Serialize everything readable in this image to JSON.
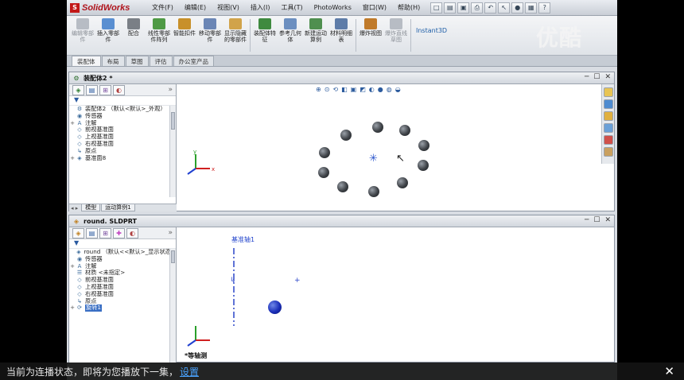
{
  "app": {
    "name": "SolidWorks",
    "menus": [
      "文件(F)",
      "编辑(E)",
      "视图(V)",
      "插入(I)",
      "工具(T)",
      "PhotoWorks",
      "窗口(W)",
      "帮助(H)"
    ]
  },
  "ribbon": {
    "buttons": [
      {
        "label": "编辑零部件",
        "icon": "edit-component-icon",
        "color": "#b7bcc4",
        "dim": true
      },
      {
        "label": "插入零部件",
        "icon": "insert-component-icon",
        "color": "#5a8fd1",
        "dim": false
      },
      {
        "label": "配合",
        "icon": "mate-icon",
        "color": "#7a7f86",
        "dim": false
      },
      {
        "label": "线性零部件阵列",
        "icon": "linear-pattern-icon",
        "color": "#4f9a45",
        "dim": false
      },
      {
        "label": "智能扣件",
        "icon": "smart-fastener-icon",
        "color": "#c8902a",
        "dim": false
      },
      {
        "label": "移动零部件",
        "icon": "move-component-icon",
        "color": "#6b86b5",
        "dim": false
      },
      {
        "label": "显示隐藏的零部件",
        "icon": "show-hidden-icon",
        "color": "#d1a34a",
        "dim": false
      },
      {
        "label": "装配体特征",
        "icon": "assembly-feature-icon",
        "color": "#3f8a3f",
        "dim": false
      },
      {
        "label": "参考几何体",
        "icon": "reference-geometry-icon",
        "color": "#6c8fc0",
        "dim": false
      },
      {
        "label": "新建运动算例",
        "icon": "motion-study-icon",
        "color": "#4f8f4f",
        "dim": false
      },
      {
        "label": "材料明细表",
        "icon": "bom-icon",
        "color": "#5e7ca8",
        "dim": false
      },
      {
        "label": "爆炸视图",
        "icon": "exploded-view-icon",
        "color": "#c07a2a",
        "dim": false
      },
      {
        "label": "爆炸直线草图",
        "icon": "explode-line-sketch-icon",
        "color": "#b7bcc4",
        "dim": true
      }
    ],
    "instant3d": "Instant3D"
  },
  "command_tabs": [
    "装配体",
    "布局",
    "草图",
    "评估",
    "办公室产品"
  ],
  "window1": {
    "title": "装配体2 *",
    "tree_items": [
      {
        "plus": "",
        "icon": "assembly-icon",
        "glyph": "⚙",
        "label": "装配体2 （默认<默认>_外观）"
      },
      {
        "plus": "",
        "icon": "sensor-icon",
        "glyph": "◉",
        "label": "传感器"
      },
      {
        "plus": "+",
        "icon": "annotation-icon",
        "glyph": "A",
        "label": "注解"
      },
      {
        "plus": "",
        "icon": "plane-icon",
        "glyph": "◇",
        "label": "前视基准面"
      },
      {
        "plus": "",
        "icon": "plane-icon",
        "glyph": "◇",
        "label": "上视基准面"
      },
      {
        "plus": "",
        "icon": "plane-icon",
        "glyph": "◇",
        "label": "右视基准面"
      },
      {
        "plus": "",
        "icon": "origin-icon",
        "glyph": "↳",
        "label": "原点"
      },
      {
        "plus": "+",
        "icon": "part-icon",
        "glyph": "◈",
        "label": "基准面8"
      }
    ],
    "bottom_tabs": [
      "模型",
      "运动算例1"
    ]
  },
  "window2": {
    "title": "round. SLDPRT",
    "tree_items": [
      {
        "plus": "",
        "icon": "part-icon",
        "glyph": "◈",
        "label": "round （默认<<默认>_显示状态>"
      },
      {
        "plus": "",
        "icon": "sensor-icon",
        "glyph": "◉",
        "label": "传感器"
      },
      {
        "plus": "+",
        "icon": "annotation-icon",
        "glyph": "A",
        "label": "注解"
      },
      {
        "plus": "",
        "icon": "material-icon",
        "glyph": "☰",
        "label": "材质 <未指定>"
      },
      {
        "plus": "",
        "icon": "plane-icon",
        "glyph": "◇",
        "label": "前视基准面"
      },
      {
        "plus": "",
        "icon": "plane-icon",
        "glyph": "◇",
        "label": "上视基准面"
      },
      {
        "plus": "",
        "icon": "plane-icon",
        "glyph": "◇",
        "label": "右视基准面"
      },
      {
        "plus": "",
        "icon": "origin-icon",
        "glyph": "↳",
        "label": "原点"
      },
      {
        "plus": "+",
        "icon": "revolve-icon",
        "glyph": "⟳",
        "label": "旋转1"
      }
    ],
    "axis_label": "基准轴1",
    "view_label": "*等轴测"
  },
  "overlay": {
    "notice": "当前为连播状态，即将为您播放下一集，",
    "link": "设置",
    "watermark": "优酷"
  }
}
